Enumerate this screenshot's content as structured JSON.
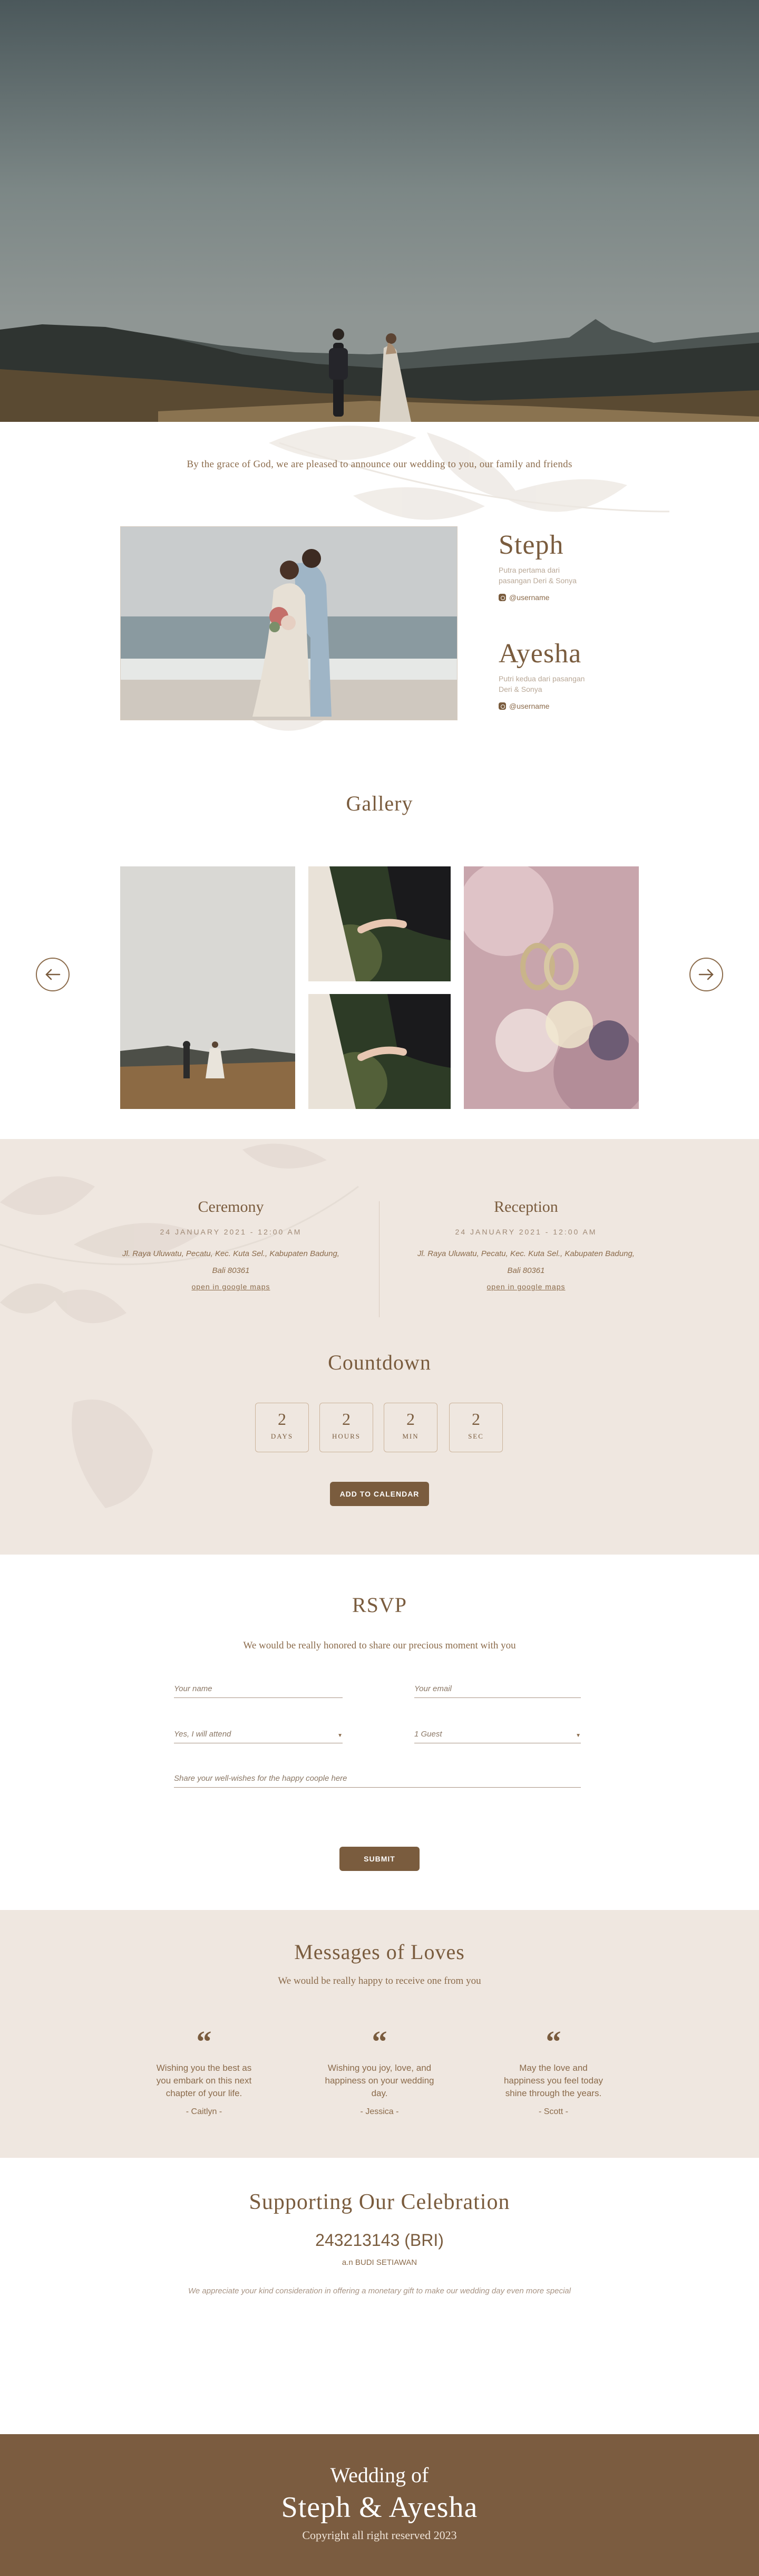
{
  "intro": {
    "announcement": "By the grace of God, we are pleased to announce our wedding to you, our family and friends"
  },
  "groom": {
    "name": "Steph",
    "sub": "Putra pertama dari pasangan Deri & Sonya",
    "instagram": "@username"
  },
  "bride": {
    "name": "Ayesha",
    "sub": "Putri kedua dari pasangan Deri & Sonya",
    "instagram": "@username"
  },
  "gallery": {
    "title": "Gallery"
  },
  "ceremony": {
    "title": "Ceremony",
    "date": "24 JANUARY 2021 - 12:00 AM",
    "address": "Jl. Raya Uluwatu, Pecatu, Kec. Kuta Sel., Kabupaten Badung, Bali 80361",
    "map_link": "open in google maps"
  },
  "reception": {
    "title": "Reception",
    "date": "24 JANUARY 2021 - 12:00 AM",
    "address": "Jl. Raya Uluwatu, Pecatu, Kec. Kuta Sel., Kabupaten Badung, Bali 80361",
    "map_link": "open in google maps"
  },
  "countdown": {
    "title": "Countdown",
    "days": "2",
    "days_label": "DAYS",
    "hours": "2",
    "hours_label": "HOURS",
    "min": "2",
    "min_label": "MIN",
    "sec": "2",
    "sec_label": "SEC",
    "calendar_button": "ADD TO CALENDAR"
  },
  "rsvp": {
    "title": "RSVP",
    "subtitle": "We would be really honored to share our precious moment with you",
    "name_placeholder": "Your name",
    "email_placeholder": "Your email",
    "attend_value": "Yes, I will attend",
    "guests_value": "1 Guest",
    "wishes_placeholder": "Share your well-wishes for the happy coople here",
    "submit": "SUBMIT"
  },
  "messages": {
    "title": "Messages of Loves",
    "subtitle": "We would be really happy to receive one from you",
    "items": [
      {
        "text": "Wishing you the best as you embark on this next chapter of your life.",
        "author": "- Caitlyn -"
      },
      {
        "text": "Wishing you joy, love, and happiness on your wedding day.",
        "author": "- Jessica -"
      },
      {
        "text": "May the love and happiness you feel today shine through the years.",
        "author": "- Scott -"
      }
    ]
  },
  "support": {
    "title": "Supporting Our Celebration",
    "account": "243213143 (BRI)",
    "holder": "a.n BUDI SETIAWAN",
    "note": "We appreciate your kind consideration in offering a monetary gift to make our wedding day even more special"
  },
  "footer": {
    "wedding_of": "Wedding of",
    "couple": "Steph & Ayesha",
    "copyright": "Copyright all right reserved 2023"
  },
  "colors": {
    "brown": "#7a5c3e",
    "beige": "#efe7e0",
    "footer": "#7b5c40"
  }
}
